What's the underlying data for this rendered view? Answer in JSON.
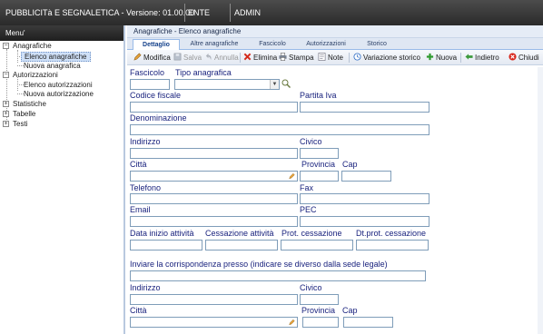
{
  "topbar": {
    "app_title": "PUBBLICITà E SEGNALETICA - Versione: 01.00.00",
    "ente": "ENTE",
    "user": "ADMIN"
  },
  "sidebar": {
    "title": "Menu'",
    "groups": [
      {
        "label": "Anagrafiche",
        "expanded": true,
        "children": [
          "Elenco anagrafiche",
          "Nuova anagrafica"
        ]
      },
      {
        "label": "Autorizzazioni",
        "expanded": true,
        "children": [
          "Elenco autorizzazioni",
          "Nuova autorizzazione"
        ]
      },
      {
        "label": "Statistiche",
        "expanded": false,
        "children": []
      },
      {
        "label": "Tabelle",
        "expanded": false,
        "children": []
      },
      {
        "label": "Testi",
        "expanded": false,
        "children": []
      }
    ],
    "selected": "Elenco anagrafiche"
  },
  "main": {
    "header": "Anagrafiche - Elenco anagrafiche",
    "tabs": [
      {
        "label": "Dettaglio",
        "active": true
      },
      {
        "label": "Altre anagrafiche",
        "active": false
      },
      {
        "label": "Fascicolo",
        "active": false
      },
      {
        "label": "Autorizzazioni",
        "active": false
      },
      {
        "label": "Storico",
        "active": false
      }
    ],
    "toolbar": {
      "modifica": "Modifica",
      "salva": "Salva",
      "annulla": "Annulla",
      "elimina": "Elimina",
      "stampa": "Stampa",
      "note": "Note",
      "variazione_storico": "Variazione storico",
      "nuova": "Nuova",
      "indietro": "Indietro",
      "chiudi": "Chiudi"
    },
    "form": {
      "fascicolo": {
        "label": "Fascicolo",
        "value": ""
      },
      "tipo_anagrafica": {
        "label": "Tipo anagrafica",
        "value": ""
      },
      "codice_fiscale": {
        "label": "Codice fiscale",
        "value": ""
      },
      "partita_iva": {
        "label": "Partita Iva",
        "value": ""
      },
      "denominazione": {
        "label": "Denominazione",
        "value": ""
      },
      "indirizzo": {
        "label": "Indirizzo",
        "value": ""
      },
      "civico": {
        "label": "Civico",
        "value": ""
      },
      "citta": {
        "label": "Città",
        "value": ""
      },
      "provincia": {
        "label": "Provincia",
        "value": ""
      },
      "cap": {
        "label": "Cap",
        "value": ""
      },
      "telefono": {
        "label": "Telefono",
        "value": ""
      },
      "fax": {
        "label": "Fax",
        "value": ""
      },
      "email": {
        "label": "Email",
        "value": ""
      },
      "pec": {
        "label": "PEC",
        "value": ""
      },
      "data_inizio": {
        "label": "Data inizio attività",
        "value": ""
      },
      "cessazione_attivita": {
        "label": "Cessazione attività",
        "value": ""
      },
      "prot_cessazione": {
        "label": "Prot. cessazione",
        "value": ""
      },
      "dt_prot_cessazione": {
        "label": "Dt.prot. cessazione",
        "value": ""
      },
      "corrispondenza": {
        "label": "Inviare la corrispondenza presso (indicare se diverso dalla sede legale)",
        "value": ""
      },
      "indirizzo2": {
        "label": "Indirizzo",
        "value": ""
      },
      "civico2": {
        "label": "Civico",
        "value": ""
      },
      "citta2": {
        "label": "Città",
        "value": ""
      },
      "provincia2": {
        "label": "Provincia",
        "value": ""
      },
      "cap2": {
        "label": "Cap",
        "value": ""
      }
    }
  },
  "colors": {
    "label_text": "#1a237e",
    "field_border": "#7f9db9",
    "tab_border": "#99bbe8",
    "selected_item_bg": "#cfe0f7"
  }
}
